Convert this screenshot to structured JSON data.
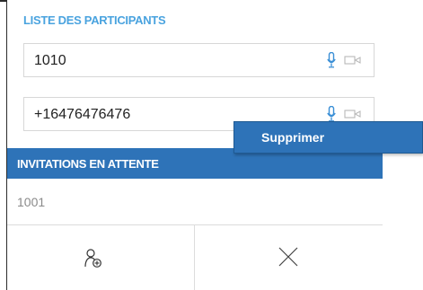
{
  "participants_section": {
    "title": "LISTE DES PARTICIPANTS",
    "participants": [
      {
        "number": "1010"
      },
      {
        "number": "+16476476476"
      }
    ]
  },
  "pending_section": {
    "title": "INVITATIONS EN ATTENTE",
    "items": [
      {
        "number": "1001"
      }
    ]
  },
  "context_menu": {
    "items": [
      {
        "label": "Supprimer"
      }
    ]
  },
  "icons": {
    "mic": "microphone-icon",
    "camera": "camera-icon",
    "add_participant": "add-participant-icon",
    "close": "close-icon"
  },
  "colors": {
    "accent": "#4aa3df",
    "header_blue": "#2e73b8",
    "mic_blue": "#3a8fd6",
    "muted_gray": "#b9b9b9"
  }
}
